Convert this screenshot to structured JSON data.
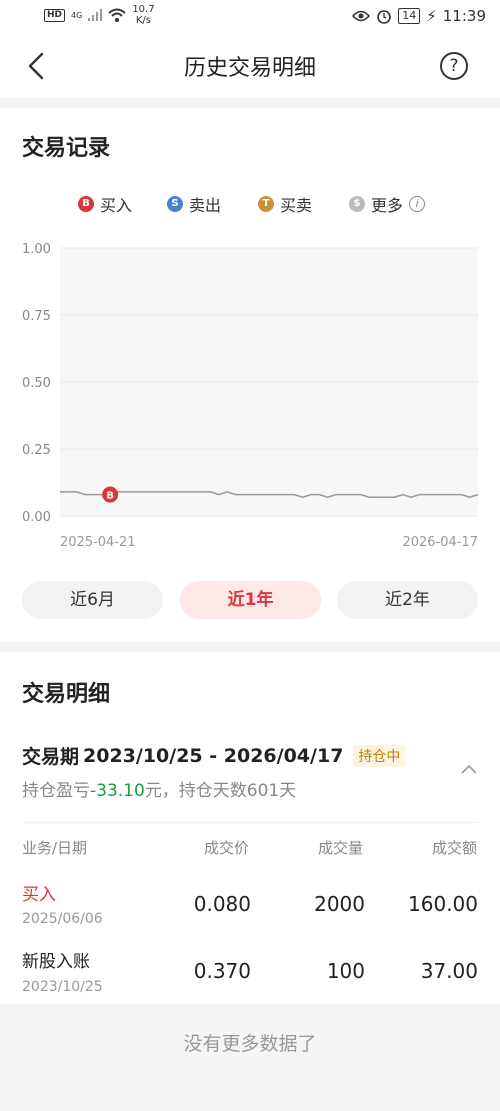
{
  "status_bar": {
    "hd": "HD",
    "network": "4G",
    "speed_value": "10.7",
    "speed_unit": "K/s",
    "battery": "14",
    "time": "11:39"
  },
  "nav": {
    "title": "历史交易明细",
    "help": "?"
  },
  "trade_record": {
    "title": "交易记录",
    "legend": [
      {
        "badge": "B",
        "label": "买入",
        "color": "#d9363e"
      },
      {
        "badge": "S",
        "label": "卖出",
        "color": "#4a7fd1"
      },
      {
        "badge": "T",
        "label": "买卖",
        "color": "#c8913c"
      },
      {
        "badge": "$",
        "label": "更多",
        "color": "#bbbbbb"
      }
    ],
    "info_icon": "i",
    "periods": [
      "近6月",
      "近1年",
      "近2年"
    ],
    "active_period": "近1年"
  },
  "chart_data": {
    "type": "line",
    "y_ticks": [
      "1.00",
      "0.75",
      "0.50",
      "0.25",
      "0.00"
    ],
    "ylim": [
      0,
      1
    ],
    "x_labels": [
      "2025-04-21",
      "2026-04-17"
    ],
    "series": [
      {
        "values": [
          0.09,
          0.09,
          0.09,
          0.08,
          0.08,
          0.08,
          0.08,
          0.09,
          0.09,
          0.09,
          0.09,
          0.09,
          0.09,
          0.09,
          0.09,
          0.09,
          0.09,
          0.09,
          0.09,
          0.08,
          0.09,
          0.08,
          0.08,
          0.08,
          0.08,
          0.08,
          0.08,
          0.08,
          0.08,
          0.07,
          0.08,
          0.08,
          0.07,
          0.08,
          0.08,
          0.08,
          0.08,
          0.07,
          0.07,
          0.07,
          0.07,
          0.08,
          0.07,
          0.08,
          0.08,
          0.08,
          0.08,
          0.08,
          0.08,
          0.07,
          0.08
        ]
      }
    ],
    "markers": [
      {
        "badge": "B",
        "value": 0.08,
        "index": 6
      }
    ]
  },
  "trade_detail": {
    "title": "交易明细",
    "period_prefix": "交易期",
    "period_range": "2023/10/25 - 2026/04/17",
    "holding_badge": "持仓中",
    "summary_prefix": "持仓盈亏",
    "summary_pnl": "-33.10",
    "summary_suffix": "元，持仓天数601天",
    "headers": [
      "业务/日期",
      "成交价",
      "成交量",
      "成交额"
    ],
    "rows": [
      {
        "type": "买入",
        "type_color": "#d9363e",
        "date": "2025/06/06",
        "price": "0.080",
        "qty": "2000",
        "amount": "160.00"
      },
      {
        "type": "新股入账",
        "type_color": "#222222",
        "date": "2023/10/25",
        "price": "0.370",
        "qty": "100",
        "amount": "37.00"
      }
    ]
  },
  "footer": {
    "text": "没有更多数据了"
  }
}
